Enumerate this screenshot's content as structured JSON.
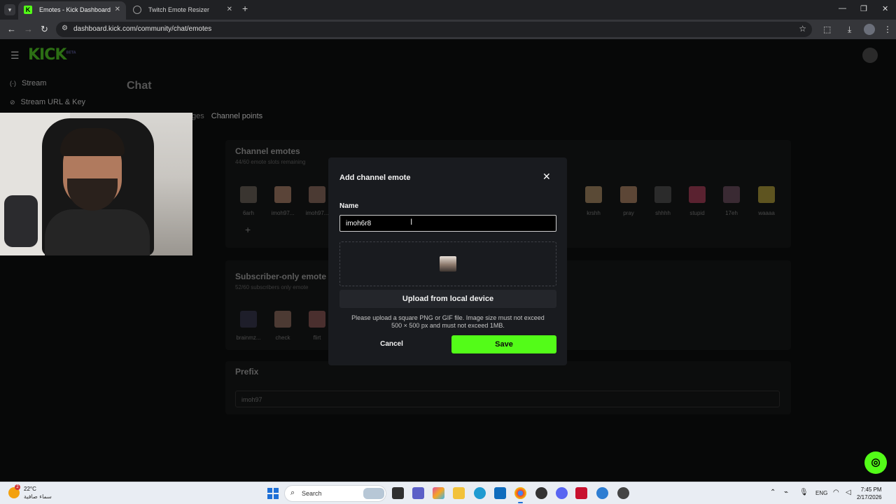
{
  "browser": {
    "tabs": [
      {
        "title": "Emotes - Kick Dashboard",
        "favicon": "K",
        "active": true
      },
      {
        "title": "Twitch Emote Resizer",
        "favicon": "",
        "active": false
      }
    ],
    "url": "dashboard.kick.com/community/chat/emotes"
  },
  "page": {
    "logo": "KICK",
    "logo_badge": "BETA",
    "sidebar": [
      {
        "label": "Stream",
        "icon": "broadcast-icon"
      },
      {
        "label": "Stream URL & Key",
        "icon": "link-icon"
      }
    ],
    "title": "Chat",
    "subtabs": {
      "partial": "ges",
      "selected": "Channel points"
    },
    "channel_emotes": {
      "title": "Channel emotes",
      "subtitle": "44/60 emote slots remaining",
      "emotes": [
        "6arh",
        "imoh97...",
        "imoh97...",
        "krshh",
        "pray",
        "shhhh",
        "stupid",
        "17eh",
        "waaaa"
      ]
    },
    "subscriber_emotes": {
      "title": "Subscriber-only emote",
      "subtitle": "52/60 subscribers only emote",
      "emotes": [
        "brainmz...",
        "check",
        "flirt"
      ]
    },
    "prefix": {
      "title": "Prefix",
      "value": "imoh97"
    }
  },
  "modal": {
    "title": "Add channel emote",
    "name_label": "Name",
    "name_value": "imoh6r8",
    "upload_label": "Upload from local device",
    "help_line1": "Please upload a square PNG or GIF file. Image size must not exceed",
    "help_line2": "500 × 500 px and must not exceed 1MB.",
    "cancel_label": "Cancel",
    "save_label": "Save"
  },
  "taskbar": {
    "temperature": "22°C",
    "weather_condition": "سماء صافية",
    "weather_badge": "2",
    "search_placeholder": "Search",
    "language": "ENG",
    "time": "7:45 PM",
    "date": "2/17/2026"
  },
  "colors": {
    "brand": "#53fc18",
    "modal_bg": "#191b1f",
    "page_bg": "#070808"
  }
}
